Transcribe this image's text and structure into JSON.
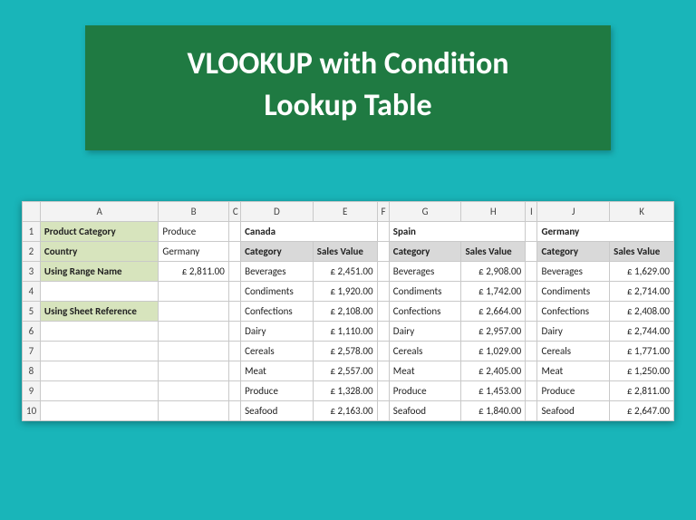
{
  "title": {
    "line1": "VLOOKUP with Condition",
    "line2": "Lookup Table"
  },
  "columns": [
    "A",
    "B",
    "C",
    "D",
    "E",
    "F",
    "G",
    "H",
    "I",
    "J",
    "K"
  ],
  "rows": [
    "1",
    "2",
    "3",
    "4",
    "5",
    "6",
    "7",
    "8",
    "9",
    "10"
  ],
  "left": {
    "product_category_label": "Product Category",
    "product_category_value": "Produce",
    "country_label": "Country",
    "country_value": "Germany",
    "range_label": "Using Range Name",
    "range_value": "£    2,811.00",
    "sheet_label": "Using Sheet Reference",
    "sheet_value": ""
  },
  "tables": {
    "canada": {
      "title": "Canada",
      "hdr_cat": "Category",
      "hdr_val": "Sales Value",
      "rows": [
        {
          "cat": "Beverages",
          "val": "£ 2,451.00"
        },
        {
          "cat": "Condiments",
          "val": "£ 1,920.00"
        },
        {
          "cat": "Confections",
          "val": "£ 2,108.00"
        },
        {
          "cat": "Dairy",
          "val": "£ 1,110.00"
        },
        {
          "cat": "Cereals",
          "val": "£ 2,578.00"
        },
        {
          "cat": "Meat",
          "val": "£ 2,557.00"
        },
        {
          "cat": "Produce",
          "val": "£ 1,328.00"
        },
        {
          "cat": "Seafood",
          "val": "£ 2,163.00"
        }
      ]
    },
    "spain": {
      "title": "Spain",
      "hdr_cat": "Category",
      "hdr_val": "Sales Value",
      "rows": [
        {
          "cat": "Beverages",
          "val": "£ 2,908.00"
        },
        {
          "cat": "Condiments",
          "val": "£ 1,742.00"
        },
        {
          "cat": "Confections",
          "val": "£ 2,664.00"
        },
        {
          "cat": "Dairy",
          "val": "£ 2,957.00"
        },
        {
          "cat": "Cereals",
          "val": "£ 1,029.00"
        },
        {
          "cat": "Meat",
          "val": "£ 2,405.00"
        },
        {
          "cat": "Produce",
          "val": "£ 1,453.00"
        },
        {
          "cat": "Seafood",
          "val": "£ 1,840.00"
        }
      ]
    },
    "germany": {
      "title": "Germany",
      "hdr_cat": "Category",
      "hdr_val": "Sales Value",
      "rows": [
        {
          "cat": "Beverages",
          "val": "£ 1,629.00"
        },
        {
          "cat": "Condiments",
          "val": "£ 2,714.00"
        },
        {
          "cat": "Confections",
          "val": "£ 2,408.00"
        },
        {
          "cat": "Dairy",
          "val": "£ 2,744.00"
        },
        {
          "cat": "Cereals",
          "val": "£ 1,771.00"
        },
        {
          "cat": "Meat",
          "val": "£ 1,250.00"
        },
        {
          "cat": "Produce",
          "val": "£ 2,811.00"
        },
        {
          "cat": "Seafood",
          "val": "£ 2,647.00"
        }
      ]
    }
  }
}
